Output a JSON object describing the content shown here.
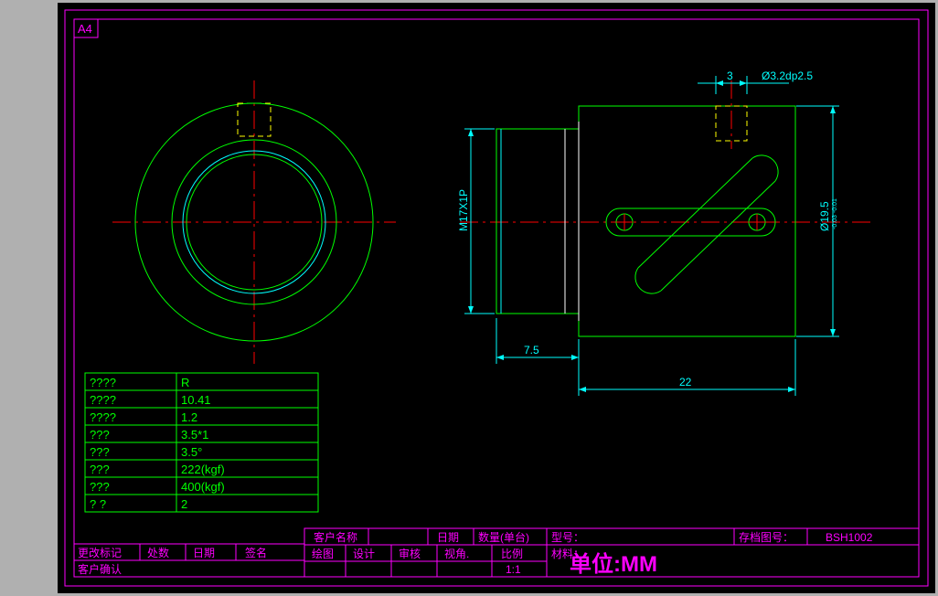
{
  "sheet_size": "A4",
  "dimensions": {
    "top_hole_width": "3",
    "hole_callout": "Ø3.2dp2.5",
    "thread_callout": "M17X1P",
    "diameter_right": "Ø19.5",
    "diameter_tol_upper": "-0.01",
    "diameter_tol_lower": "-0.03",
    "length_short": "7.5",
    "length_long": "22"
  },
  "spec_table": {
    "rows": [
      {
        "label": "????",
        "value": "R"
      },
      {
        "label": "????",
        "value": "10.41"
      },
      {
        "label": "????",
        "value": "1.2"
      },
      {
        "label": "???",
        "value": "3.5*1"
      },
      {
        "label": "???",
        "value": "3.5°"
      },
      {
        "label": "???",
        "value": "222(kgf)"
      },
      {
        "label": "???",
        "value": "400(kgf)"
      },
      {
        "label": "?  ?",
        "value": "2"
      }
    ]
  },
  "title_block": {
    "customer_name_label": "客户名称",
    "date_label": "日期",
    "quantity_label": "数量(单台)",
    "model_label": "型号：",
    "drawing_no_label": "存档图号：",
    "drawing_no": "BSH1002",
    "material_label": "材料：",
    "drawn_label": "绘图",
    "design_label": "设计",
    "check_label": "审核",
    "view_label": "视角.",
    "scale_label": "比例",
    "scale": "1:1",
    "unit_label": "单位:MM",
    "change_mark_label": "更改标记",
    "position_label": "处数",
    "date2_label": "日期",
    "sign_label": "签名",
    "customer_confirm_label": "客户确认"
  }
}
